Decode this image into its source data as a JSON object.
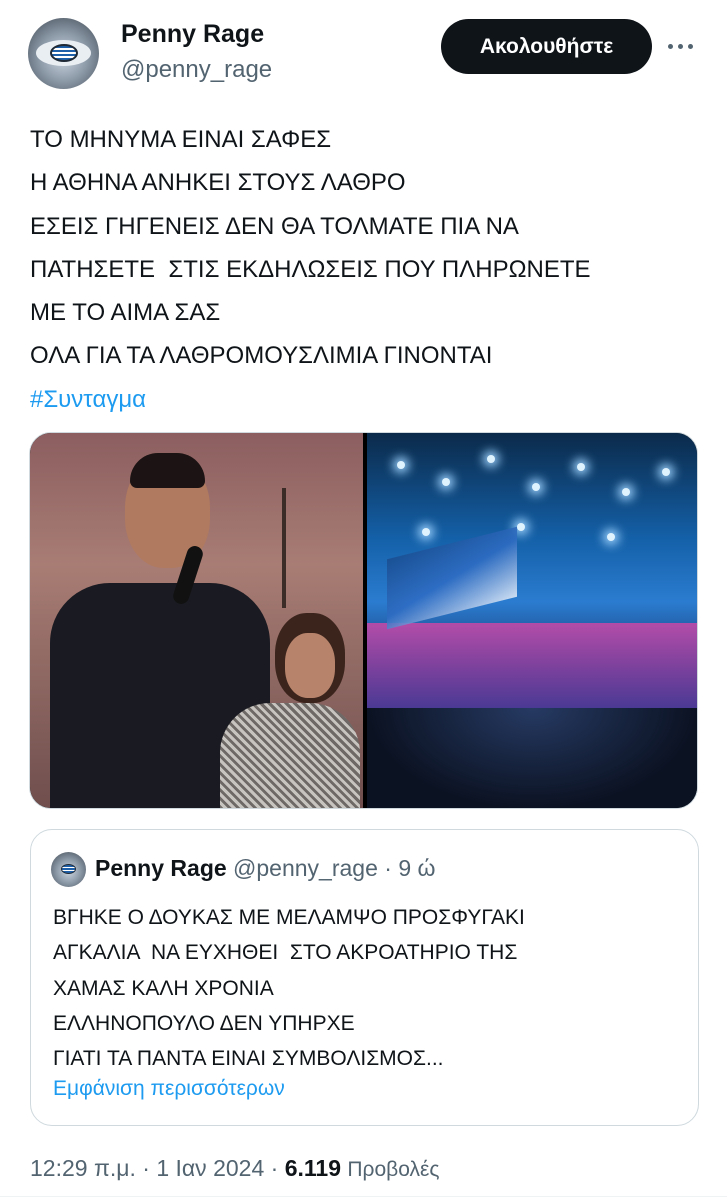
{
  "header": {
    "display_name": "Penny Rage",
    "handle": "@penny_rage",
    "follow_label": "Ακολουθήστε",
    "more_icon": "more-horizontal-icon"
  },
  "tweet": {
    "lines": [
      "ΤΟ ΜΗΝΥΜΑ ΕΙΝΑΙ ΣΑΦΕΣ",
      "Η ΑΘΗΝΑ ΑΝΗΚΕΙ ΣΤΟΥΣ ΛΑΘΡΟ",
      "ΕΣΕΙΣ ΓΗΓΕΝΕΙΣ ΔΕΝ ΘΑ ΤΟΛΜΑΤΕ ΠΙΑ ΝΑ",
      "ΠΑΤΗΣΕΤΕ  ΣΤΙΣ ΕΚΔΗΛΩΣΕΙΣ ΠΟΥ ΠΛΗΡΩΝΕΤΕ",
      "ΜΕ ΤΟ ΑΙΜΑ ΣΑΣ",
      "ΟΛΑ ΓΙΑ ΤΑ ΛΑΘΡΟΜΟΥΣΛΙΜΙΑ ΓΙΝΟΝΤΑΙ"
    ],
    "hashtag": "#Συνταγμα"
  },
  "quoted_tweet": {
    "display_name": "Penny Rage",
    "handle": "@penny_rage",
    "separator": "·",
    "time": "9 ώ",
    "lines": [
      "ΒΓΗΚΕ Ο ΔΟΥΚΑΣ ΜΕ ΜΕΛΑΜΨΟ ΠΡΟΣΦΥΓΑΚΙ",
      "ΑΓΚΑΛΙΑ  ΝΑ ΕΥΧΗΘΕΙ  ΣΤΟ ΑΚΡΟΑΤΗΡΙΟ ΤΗΣ",
      "ΧΑΜΑΣ ΚΑΛΗ ΧΡΟΝΙΑ",
      "ΕΛΛΗΝΟΠΟΥΛΟ ΔΕΝ ΥΠΗΡΧΕ",
      "ΓΙΑΤΙ ΤΑ ΠΑΝΤΑ ΕΙΝΑΙ ΣΥΜΒΟΛΙΣΜΟΣ..."
    ],
    "show_more": "Εμφάνιση περισσότερων"
  },
  "footer": {
    "time": "12:29 π.μ.",
    "sep1": "·",
    "date": "1 Ιαν 2024",
    "sep2": "·",
    "views_count": "6.119",
    "views_label": "Προβολές"
  },
  "colors": {
    "text": "#0f1419",
    "secondary": "#536471",
    "link": "#1d9bf0",
    "border": "#cfd9de",
    "button_bg": "#0f1419"
  }
}
